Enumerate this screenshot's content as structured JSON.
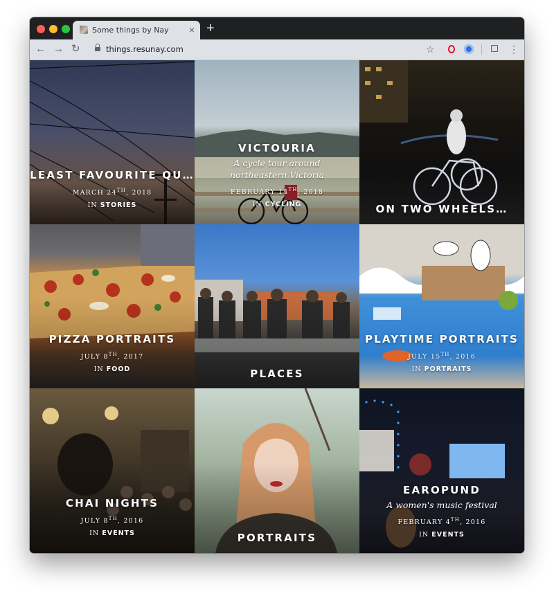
{
  "browser": {
    "tab_title": "Some things by Nay",
    "url": "things.resunay.com",
    "new_tab_symbol": "+",
    "tab_close_symbol": "×"
  },
  "tiles": [
    {
      "title": "LEAST FAVOURITE QU…",
      "subtitle": "",
      "date_day": "MARCH 24",
      "date_suffix": "TH",
      "date_year": ", 2018",
      "in_label": "IN",
      "category": "STORIES"
    },
    {
      "title": "VICTOURIA",
      "subtitle": "A cycle tour around northeastern Victoria",
      "date_day": "FEBRUARY 14",
      "date_suffix": "TH",
      "date_year": ", 2018",
      "in_label": "IN",
      "category": "CYCLING"
    },
    {
      "title": "ON TWO WHEELS…",
      "subtitle": "",
      "date_day": "",
      "date_suffix": "",
      "date_year": "",
      "in_label": "",
      "category": ""
    },
    {
      "title": "PIZZA PORTRAITS",
      "subtitle": "",
      "date_day": "JULY 8",
      "date_suffix": "TH",
      "date_year": ", 2017",
      "in_label": "IN",
      "category": "FOOD"
    },
    {
      "title": "PLACES",
      "subtitle": "",
      "date_day": "",
      "date_suffix": "",
      "date_year": "",
      "in_label": "",
      "category": ""
    },
    {
      "title": "PLAYTIME PORTRAITS",
      "subtitle": "",
      "date_day": "JULY 15",
      "date_suffix": "TH",
      "date_year": ", 2016",
      "in_label": "IN",
      "category": "PORTRAITS"
    },
    {
      "title": "CHAI NIGHTS",
      "subtitle": "",
      "date_day": "JULY 8",
      "date_suffix": "TH",
      "date_year": ", 2016",
      "in_label": "IN",
      "category": "EVENTS"
    },
    {
      "title": "PORTRAITS",
      "subtitle": "",
      "date_day": "",
      "date_suffix": "",
      "date_year": "",
      "in_label": "",
      "category": ""
    },
    {
      "title": "EAROPUND",
      "subtitle": "A women's music festival",
      "date_day": "FEBRUARY 4",
      "date_suffix": "TH",
      "date_year": ", 2016",
      "in_label": "IN",
      "category": "EVENTS"
    }
  ]
}
